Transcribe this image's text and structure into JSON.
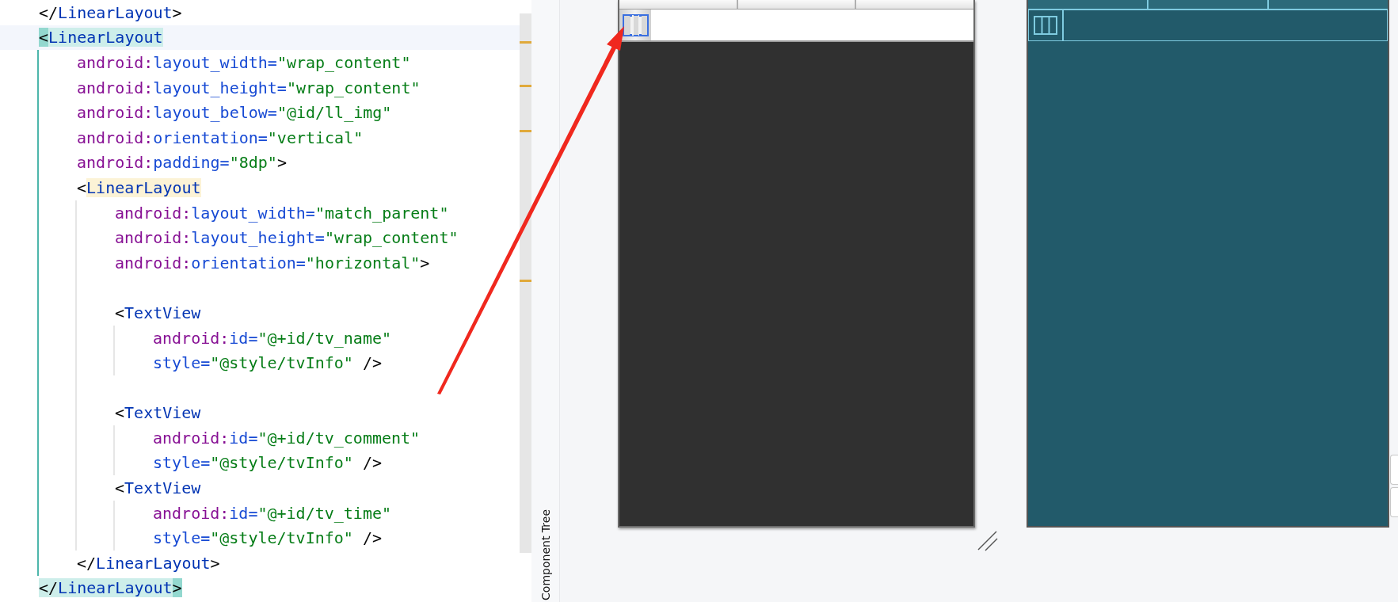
{
  "editor": {
    "lines": [
      {
        "kind": "code",
        "current": false,
        "tokens": [
          {
            "kind": "punct",
            "text": "</"
          },
          {
            "kind": "tag",
            "text": "LinearLayout"
          },
          {
            "kind": "punct",
            "text": ">"
          }
        ]
      },
      {
        "kind": "code",
        "current": true,
        "tokens": [
          {
            "kind": "bracket-match",
            "text": "<"
          },
          {
            "kind": "tag-match",
            "text": "LinearLayout"
          }
        ],
        "children": [
          {
            "kind": "code",
            "current": false,
            "tokens": [
              {
                "kind": "ns",
                "text": "android:"
              },
              {
                "kind": "attr",
                "text": "layout_width="
              },
              {
                "kind": "value",
                "text": "\"wrap_content\""
              }
            ]
          },
          {
            "kind": "code",
            "current": false,
            "tokens": [
              {
                "kind": "ns",
                "text": "android:"
              },
              {
                "kind": "attr",
                "text": "layout_height="
              },
              {
                "kind": "value",
                "text": "\"wrap_content\""
              }
            ]
          },
          {
            "kind": "code",
            "current": false,
            "tokens": [
              {
                "kind": "ns",
                "text": "android:"
              },
              {
                "kind": "attr",
                "text": "layout_below="
              },
              {
                "kind": "value",
                "text": "\"@id/ll_img\""
              }
            ]
          },
          {
            "kind": "code",
            "current": false,
            "tokens": [
              {
                "kind": "ns",
                "text": "android:"
              },
              {
                "kind": "attr",
                "text": "orientation="
              },
              {
                "kind": "value",
                "text": "\"vertical\""
              }
            ]
          },
          {
            "kind": "code",
            "current": false,
            "tokens": [
              {
                "kind": "ns",
                "text": "android:"
              },
              {
                "kind": "attr",
                "text": "padding="
              },
              {
                "kind": "value",
                "text": "\"8dp\""
              },
              {
                "kind": "punct",
                "text": ">"
              }
            ]
          },
          {
            "kind": "code",
            "current": false,
            "tokens": [
              {
                "kind": "punct",
                "text": "<"
              },
              {
                "kind": "tag-usage",
                "text": "LinearLayout"
              }
            ],
            "children": [
              {
                "kind": "code",
                "current": false,
                "tokens": [
                  {
                    "kind": "ns",
                    "text": "android:"
                  },
                  {
                    "kind": "attr",
                    "text": "layout_width="
                  },
                  {
                    "kind": "value",
                    "text": "\"match_parent\""
                  }
                ]
              },
              {
                "kind": "code",
                "current": false,
                "tokens": [
                  {
                    "kind": "ns",
                    "text": "android:"
                  },
                  {
                    "kind": "attr",
                    "text": "layout_height="
                  },
                  {
                    "kind": "value",
                    "text": "\"wrap_content\""
                  }
                ]
              },
              {
                "kind": "code",
                "current": false,
                "tokens": [
                  {
                    "kind": "ns",
                    "text": "android:"
                  },
                  {
                    "kind": "attr",
                    "text": "orientation="
                  },
                  {
                    "kind": "value",
                    "text": "\"horizontal\""
                  },
                  {
                    "kind": "punct",
                    "text": ">"
                  }
                ]
              },
              {
                "kind": "blank"
              },
              {
                "kind": "code",
                "current": false,
                "tokens": [
                  {
                    "kind": "punct",
                    "text": "<"
                  },
                  {
                    "kind": "tag",
                    "text": "TextView"
                  }
                ],
                "children": [
                  {
                    "kind": "code",
                    "current": false,
                    "tokens": [
                      {
                        "kind": "ns",
                        "text": "android:"
                      },
                      {
                        "kind": "attr",
                        "text": "id="
                      },
                      {
                        "kind": "value",
                        "text": "\"@+id/tv_name\""
                      }
                    ]
                  },
                  {
                    "kind": "code",
                    "current": false,
                    "tokens": [
                      {
                        "kind": "attr",
                        "text": "style="
                      },
                      {
                        "kind": "value",
                        "text": "\"@style/tvInfo\""
                      },
                      {
                        "kind": "punct",
                        "text": " />"
                      }
                    ]
                  }
                ]
              },
              {
                "kind": "blank"
              },
              {
                "kind": "code",
                "current": false,
                "tokens": [
                  {
                    "kind": "punct",
                    "text": "<"
                  },
                  {
                    "kind": "tag",
                    "text": "TextView"
                  }
                ],
                "children": [
                  {
                    "kind": "code",
                    "current": false,
                    "tokens": [
                      {
                        "kind": "ns",
                        "text": "android:"
                      },
                      {
                        "kind": "attr",
                        "text": "id="
                      },
                      {
                        "kind": "value",
                        "text": "\"@+id/tv_comment\""
                      }
                    ]
                  },
                  {
                    "kind": "code",
                    "current": false,
                    "tokens": [
                      {
                        "kind": "attr",
                        "text": "style="
                      },
                      {
                        "kind": "value",
                        "text": "\"@style/tvInfo\""
                      },
                      {
                        "kind": "punct",
                        "text": " />"
                      }
                    ]
                  }
                ]
              },
              {
                "kind": "code",
                "current": false,
                "tokens": [
                  {
                    "kind": "punct",
                    "text": "<"
                  },
                  {
                    "kind": "tag",
                    "text": "TextView"
                  }
                ],
                "children": [
                  {
                    "kind": "code",
                    "current": false,
                    "tokens": [
                      {
                        "kind": "ns",
                        "text": "android:"
                      },
                      {
                        "kind": "attr",
                        "text": "id="
                      },
                      {
                        "kind": "value",
                        "text": "\"@+id/tv_time\""
                      }
                    ]
                  },
                  {
                    "kind": "code",
                    "current": false,
                    "tokens": [
                      {
                        "kind": "attr",
                        "text": "style="
                      },
                      {
                        "kind": "value",
                        "text": "\"@style/tvInfo\""
                      },
                      {
                        "kind": "punct",
                        "text": " />"
                      }
                    ]
                  }
                ]
              }
            ]
          },
          {
            "kind": "code",
            "current": false,
            "tokens": [
              {
                "kind": "punct",
                "text": "</"
              },
              {
                "kind": "tag",
                "text": "LinearLayout"
              },
              {
                "kind": "punct",
                "text": ">"
              }
            ]
          }
        ]
      },
      {
        "kind": "code",
        "current": false,
        "tokens": [
          {
            "kind": "punct-match",
            "text": "</"
          },
          {
            "kind": "tag-match",
            "text": "LinearLayout"
          },
          {
            "kind": "bracket-match",
            "text": ">"
          }
        ]
      }
    ]
  },
  "tool_strip": {
    "label": "Component Tree"
  }
}
